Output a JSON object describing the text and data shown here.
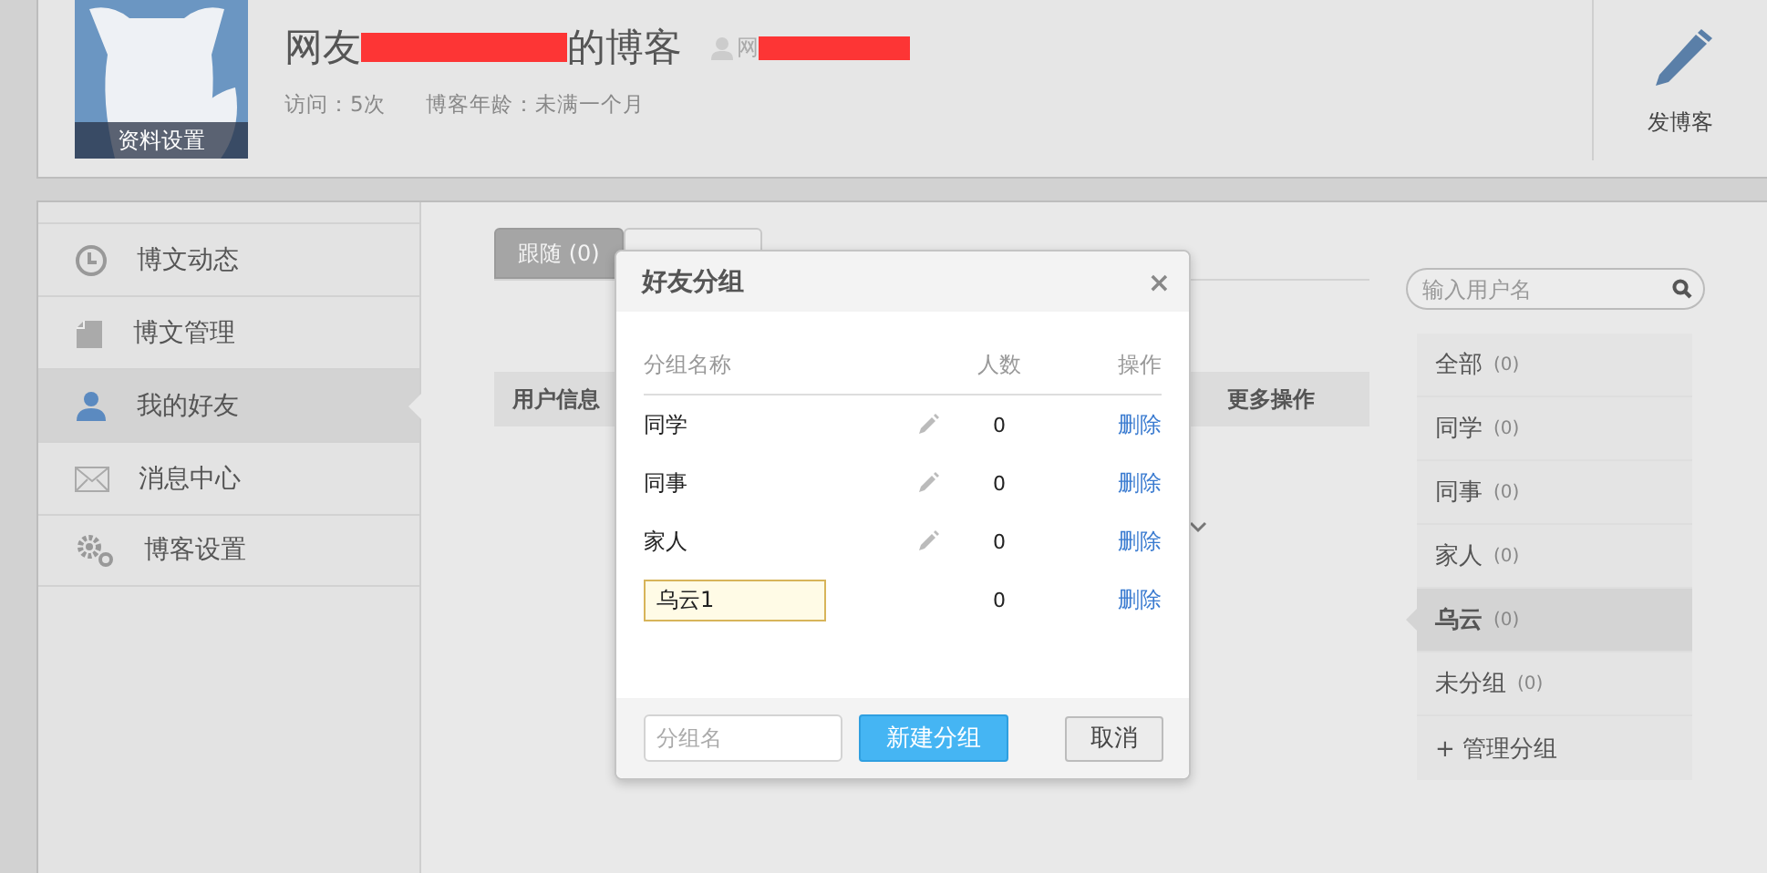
{
  "header": {
    "title_prefix": "网友",
    "title_suffix": "的博客",
    "user_prefix": "网",
    "avatar_caption": "资料设置",
    "stats": [
      "访问：5次",
      "博客年龄：未满一个月"
    ],
    "post_button": "发博客"
  },
  "sidebar": {
    "items": [
      {
        "kind": "clock",
        "label": "博文动态",
        "selected": false
      },
      {
        "kind": "document",
        "label": "博文管理",
        "selected": false
      },
      {
        "kind": "person",
        "label": "我的好友",
        "selected": true
      },
      {
        "kind": "envelope",
        "label": "消息中心",
        "selected": false
      },
      {
        "kind": "gears",
        "label": "博客设置",
        "selected": false
      }
    ]
  },
  "tabs": [
    {
      "label": "跟随 (0)",
      "selected": true
    }
  ],
  "table": {
    "columns": [
      "用户信息",
      "更多操作"
    ]
  },
  "search": {
    "placeholder": "输入用户名"
  },
  "groups": [
    {
      "name": "全部",
      "count": "(0)",
      "selected": false
    },
    {
      "name": "同学",
      "count": "(0)",
      "selected": false
    },
    {
      "name": "同事",
      "count": "(0)",
      "selected": false
    },
    {
      "name": "家人",
      "count": "(0)",
      "selected": false
    },
    {
      "name": "乌云",
      "count": "(0)",
      "selected": true
    },
    {
      "name": "未分组",
      "count": "(0)",
      "selected": false
    }
  ],
  "manage_link": "+ 管理分组",
  "dialog": {
    "title": "好友分组",
    "close": "×",
    "columns": [
      "分组名称",
      "人数",
      "操作"
    ],
    "rows": [
      {
        "name": "同学",
        "count": "0",
        "action": "删除",
        "editing": false
      },
      {
        "name": "同事",
        "count": "0",
        "action": "删除",
        "editing": false
      },
      {
        "name": "家人",
        "count": "0",
        "action": "删除",
        "editing": false
      },
      {
        "name": "乌云1",
        "count": "0",
        "action": "删除",
        "editing": true
      }
    ],
    "new_group_placeholder": "分组名",
    "create_button": "新建分组",
    "cancel_button": "取消"
  }
}
